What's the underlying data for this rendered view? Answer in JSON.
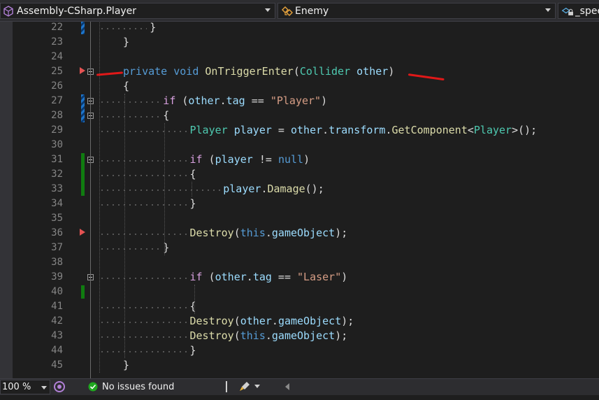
{
  "navbar": {
    "project_dropdown": "Assembly-CSharp.Player",
    "type_dropdown": "Enemy",
    "member_dropdown": "_spee"
  },
  "editor": {
    "lines": [
      {
        "num": "22",
        "tokens": [
          {
            "t": "}",
            "c": "pn"
          }
        ],
        "indent": 4
      },
      {
        "num": "23",
        "tokens": [
          {
            "t": "}",
            "c": "pn"
          }
        ],
        "indent": 0
      },
      {
        "num": "24",
        "tokens": [],
        "indent": 0
      },
      {
        "num": "25",
        "tokens": [
          {
            "t": "private ",
            "c": "kw"
          },
          {
            "t": "void ",
            "c": "kw"
          },
          {
            "t": "OnTriggerEnter",
            "c": "mth"
          },
          {
            "t": "(",
            "c": "pn"
          },
          {
            "t": "Collider ",
            "c": "ty"
          },
          {
            "t": "other",
            "c": "var"
          },
          {
            "t": ")",
            "c": "pn"
          }
        ],
        "indent": 0
      },
      {
        "num": "26",
        "tokens": [
          {
            "t": "{",
            "c": "pn"
          }
        ],
        "indent": 0
      },
      {
        "num": "27",
        "tokens": [
          {
            "t": "if ",
            "c": "ctl"
          },
          {
            "t": "(",
            "c": "pn"
          },
          {
            "t": "other",
            "c": "var"
          },
          {
            "t": ".",
            "c": "pn"
          },
          {
            "t": "tag",
            "c": "var"
          },
          {
            "t": " == ",
            "c": "pn"
          },
          {
            "t": "\"Player\"",
            "c": "str"
          },
          {
            "t": ")",
            "c": "pn"
          }
        ],
        "indent": 6
      },
      {
        "num": "28",
        "tokens": [
          {
            "t": "{",
            "c": "pn"
          }
        ],
        "indent": 6
      },
      {
        "num": "29",
        "tokens": [
          {
            "t": "Player ",
            "c": "ty"
          },
          {
            "t": "player",
            "c": "var"
          },
          {
            "t": " = ",
            "c": "pn"
          },
          {
            "t": "other",
            "c": "var"
          },
          {
            "t": ".",
            "c": "pn"
          },
          {
            "t": "transform",
            "c": "var"
          },
          {
            "t": ".",
            "c": "pn"
          },
          {
            "t": "GetComponent",
            "c": "mth"
          },
          {
            "t": "<",
            "c": "pn"
          },
          {
            "t": "Player",
            "c": "ty"
          },
          {
            "t": ">();",
            "c": "pn"
          }
        ],
        "indent": 10
      },
      {
        "num": "30",
        "tokens": [],
        "indent": 0
      },
      {
        "num": "31",
        "tokens": [
          {
            "t": "if ",
            "c": "ctl"
          },
          {
            "t": "(",
            "c": "pn"
          },
          {
            "t": "player",
            "c": "var"
          },
          {
            "t": " != ",
            "c": "pn"
          },
          {
            "t": "null",
            "c": "kw"
          },
          {
            "t": ")",
            "c": "pn"
          }
        ],
        "indent": 10
      },
      {
        "num": "32",
        "tokens": [
          {
            "t": "{",
            "c": "pn"
          }
        ],
        "indent": 10
      },
      {
        "num": "33",
        "tokens": [
          {
            "t": "player",
            "c": "var"
          },
          {
            "t": ".",
            "c": "pn"
          },
          {
            "t": "Damage",
            "c": "mth"
          },
          {
            "t": "();",
            "c": "pn"
          }
        ],
        "indent": 15
      },
      {
        "num": "34",
        "tokens": [
          {
            "t": "}",
            "c": "pn"
          }
        ],
        "indent": 10
      },
      {
        "num": "35",
        "tokens": [],
        "indent": 0
      },
      {
        "num": "36",
        "tokens": [
          {
            "t": "Destroy",
            "c": "mth"
          },
          {
            "t": "(",
            "c": "pn"
          },
          {
            "t": "this",
            "c": "kw"
          },
          {
            "t": ".",
            "c": "pn"
          },
          {
            "t": "gameObject",
            "c": "var"
          },
          {
            "t": ");",
            "c": "pn"
          }
        ],
        "indent": 10
      },
      {
        "num": "37",
        "tokens": [
          {
            "t": "}",
            "c": "pn"
          }
        ],
        "indent": 6
      },
      {
        "num": "38",
        "tokens": [],
        "indent": 0
      },
      {
        "num": "39",
        "tokens": [
          {
            "t": "if ",
            "c": "ctl"
          },
          {
            "t": "(",
            "c": "pn"
          },
          {
            "t": "other",
            "c": "var"
          },
          {
            "t": ".",
            "c": "pn"
          },
          {
            "t": "tag",
            "c": "var"
          },
          {
            "t": " == ",
            "c": "pn"
          },
          {
            "t": "\"Laser\"",
            "c": "str"
          },
          {
            "t": ")",
            "c": "pn"
          }
        ],
        "indent": 10
      },
      {
        "num": "40",
        "tokens": [],
        "indent": 0
      },
      {
        "num": "41",
        "tokens": [
          {
            "t": "{",
            "c": "pn"
          }
        ],
        "indent": 10
      },
      {
        "num": "42",
        "tokens": [
          {
            "t": "Destroy",
            "c": "mth"
          },
          {
            "t": "(",
            "c": "pn"
          },
          {
            "t": "other",
            "c": "var"
          },
          {
            "t": ".",
            "c": "pn"
          },
          {
            "t": "gameObject",
            "c": "var"
          },
          {
            "t": ");",
            "c": "pn"
          }
        ],
        "indent": 10
      },
      {
        "num": "43",
        "tokens": [
          {
            "t": "Destroy",
            "c": "mth"
          },
          {
            "t": "(",
            "c": "pn"
          },
          {
            "t": "this",
            "c": "kw"
          },
          {
            "t": ".",
            "c": "pn"
          },
          {
            "t": "gameObject",
            "c": "var"
          },
          {
            "t": ");",
            "c": "pn"
          }
        ],
        "indent": 10
      },
      {
        "num": "44",
        "tokens": [
          {
            "t": "}",
            "c": "pn"
          }
        ],
        "indent": 10
      },
      {
        "num": "45",
        "tokens": [
          {
            "t": "}",
            "c": "pn"
          }
        ],
        "indent": 0
      }
    ]
  },
  "status": {
    "zoom": "100 %",
    "issues": "No issues found"
  },
  "colors": {
    "keyword": "#569cd6",
    "control": "#d8a0df",
    "type": "#4ec9b0",
    "variable": "#9cdcfe",
    "string": "#d69d85",
    "method": "#dcdcaa",
    "ok_green": "#1fa81f",
    "annotation_red": "#e01818"
  }
}
